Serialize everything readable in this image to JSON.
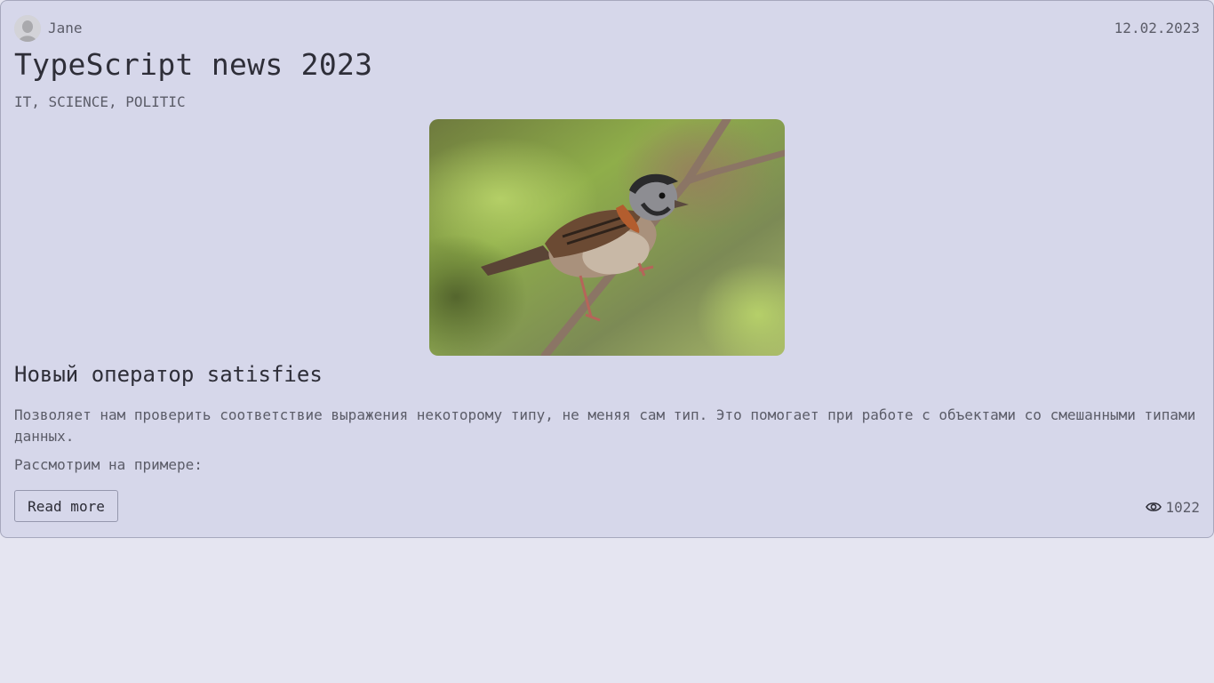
{
  "post": {
    "author": "Jane",
    "date": "12.02.2023",
    "title": "TypeScript news 2023",
    "tags": "IT, SCIENCE, POLITIC",
    "subtitle": "Новый оператор satisfies",
    "paragraph1": "Позволяет нам проверить соответствие выражения некоторому типу, не меняя сам тип. Это помогает при работе с объектами со смешанными типами данных.",
    "paragraph2": "Рассмотрим на примере:",
    "read_more_label": "Read more",
    "views": "1022"
  },
  "icons": {
    "avatar": "user-avatar",
    "views": "eye-icon"
  },
  "colors": {
    "page_bg": "#e5e5f1",
    "card_bg": "#d6d7ea",
    "card_border": "#a6a8bd",
    "text_dark": "#2e2e38",
    "text_muted": "#5b5c68"
  }
}
